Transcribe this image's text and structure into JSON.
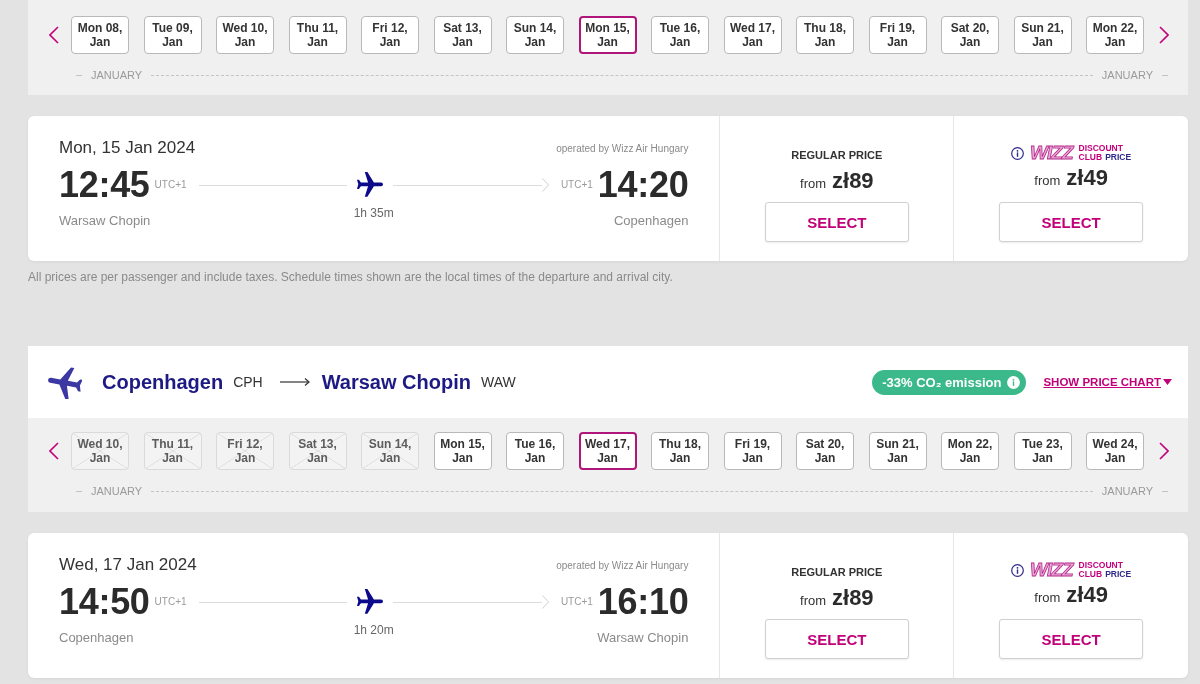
{
  "outbound": {
    "dates": {
      "month_start": "JANUARY",
      "month_end": "JANUARY",
      "days": [
        {
          "label": "Mon 08, Jan",
          "selected": false,
          "disabled": false
        },
        {
          "label": "Tue 09, Jan",
          "selected": false,
          "disabled": false
        },
        {
          "label": "Wed 10, Jan",
          "selected": false,
          "disabled": false
        },
        {
          "label": "Thu 11, Jan",
          "selected": false,
          "disabled": false
        },
        {
          "label": "Fri 12, Jan",
          "selected": false,
          "disabled": false
        },
        {
          "label": "Sat 13, Jan",
          "selected": false,
          "disabled": false
        },
        {
          "label": "Sun 14, Jan",
          "selected": false,
          "disabled": false
        },
        {
          "label": "Mon 15, Jan",
          "selected": true,
          "disabled": false
        },
        {
          "label": "Tue 16, Jan",
          "selected": false,
          "disabled": false
        },
        {
          "label": "Wed 17, Jan",
          "selected": false,
          "disabled": false
        },
        {
          "label": "Thu 18, Jan",
          "selected": false,
          "disabled": false
        },
        {
          "label": "Fri 19, Jan",
          "selected": false,
          "disabled": false
        },
        {
          "label": "Sat 20, Jan",
          "selected": false,
          "disabled": false
        },
        {
          "label": "Sun 21, Jan",
          "selected": false,
          "disabled": false
        },
        {
          "label": "Mon 22, Jan",
          "selected": false,
          "disabled": false
        }
      ]
    },
    "flight": {
      "date": "Mon, 15 Jan 2024",
      "operator": "operated by Wizz Air Hungary",
      "departure": {
        "time": "12:45",
        "timezone": "UTC+1",
        "airport": "Warsaw Chopin"
      },
      "duration": "1h 35m",
      "arrival": {
        "time": "14:20",
        "timezone": "UTC+1",
        "airport": "Copenhagen"
      }
    },
    "fares": [
      {
        "kind": "regular",
        "title": "REGULAR PRICE",
        "from": "from",
        "price": "zł89",
        "button": "SELECT"
      },
      {
        "kind": "club",
        "wordmark": "WIZZ",
        "tag_lines": [
          [
            {
              "text": "DISCOUNT",
              "color": "#c6007e"
            }
          ],
          [
            {
              "text": "CLUB",
              "color": "#c6007e"
            },
            {
              "text": "PRICE",
              "color": "#2e2a8c"
            }
          ]
        ],
        "from": "from",
        "price": "zł49",
        "button": "SELECT"
      }
    ]
  },
  "price_note": "All prices are per passenger and include taxes. Schedule times shown are the local times of the departure and arrival city.",
  "return": {
    "route": {
      "from_city": "Copenhagen",
      "from_code": "CPH",
      "to_city": "Warsaw Chopin",
      "to_code": "WAW"
    },
    "co2_badge": "-33% CO₂ emission",
    "price_chart_link": "SHOW PRICE CHART",
    "dates": {
      "month_start": "JANUARY",
      "month_end": "JANUARY",
      "days": [
        {
          "label": "Wed 10, Jan",
          "selected": false,
          "disabled": true
        },
        {
          "label": "Thu 11, Jan",
          "selected": false,
          "disabled": true
        },
        {
          "label": "Fri 12, Jan",
          "selected": false,
          "disabled": true
        },
        {
          "label": "Sat 13, Jan",
          "selected": false,
          "disabled": true
        },
        {
          "label": "Sun 14, Jan",
          "selected": false,
          "disabled": true
        },
        {
          "label": "Mon 15, Jan",
          "selected": false,
          "disabled": false
        },
        {
          "label": "Tue 16, Jan",
          "selected": false,
          "disabled": false
        },
        {
          "label": "Wed 17, Jan",
          "selected": true,
          "disabled": false
        },
        {
          "label": "Thu 18, Jan",
          "selected": false,
          "disabled": false
        },
        {
          "label": "Fri 19, Jan",
          "selected": false,
          "disabled": false
        },
        {
          "label": "Sat 20, Jan",
          "selected": false,
          "disabled": false
        },
        {
          "label": "Sun 21, Jan",
          "selected": false,
          "disabled": false
        },
        {
          "label": "Mon 22, Jan",
          "selected": false,
          "disabled": false
        },
        {
          "label": "Tue 23, Jan",
          "selected": false,
          "disabled": false
        },
        {
          "label": "Wed 24, Jan",
          "selected": false,
          "disabled": false
        }
      ]
    },
    "flight": {
      "date": "Wed, 17 Jan 2024",
      "operator": "operated by Wizz Air Hungary",
      "departure": {
        "time": "14:50",
        "timezone": "UTC+1",
        "airport": "Copenhagen"
      },
      "duration": "1h 20m",
      "arrival": {
        "time": "16:10",
        "timezone": "UTC+1",
        "airport": "Warsaw Chopin"
      }
    },
    "fares": [
      {
        "kind": "regular",
        "title": "REGULAR PRICE",
        "from": "from",
        "price": "zł89",
        "button": "SELECT"
      },
      {
        "kind": "club",
        "wordmark": "WIZZ",
        "tag_lines": [
          [
            {
              "text": "DISCOUNT",
              "color": "#c6007e"
            }
          ],
          [
            {
              "text": "CLUB",
              "color": "#c6007e"
            },
            {
              "text": "PRICE",
              "color": "#2e2a8c"
            }
          ]
        ],
        "from": "from",
        "price": "zł49",
        "button": "SELECT"
      }
    ]
  }
}
